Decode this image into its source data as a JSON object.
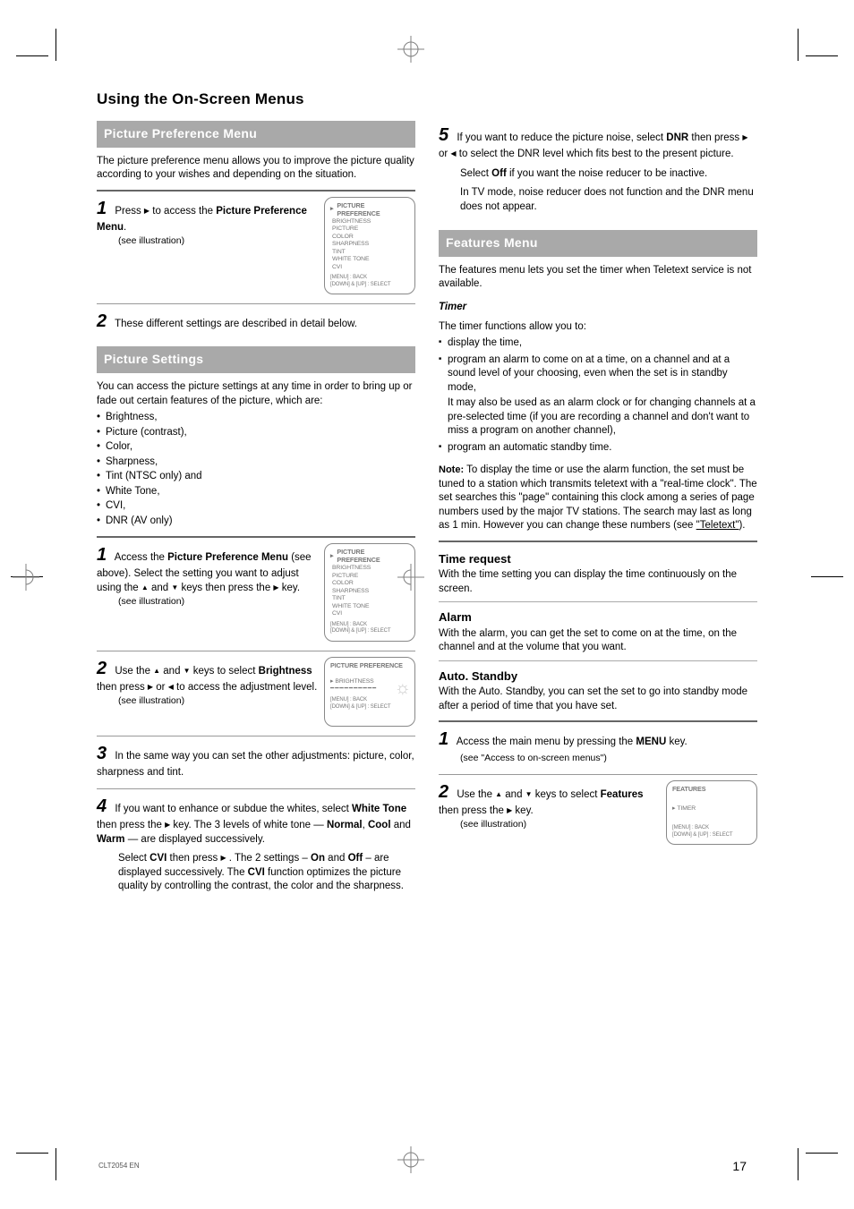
{
  "page": {
    "header": "Using the On-Screen Menus",
    "number": "17",
    "footer_model": "CLT2054 EN"
  },
  "left": {
    "sec1_title": "Picture Preference Menu",
    "sec1_p1": "The picture preference menu allows you to improve the picture quality according to your wishes and depending on the situation.",
    "step1": "Press ▶ to access the Picture Preference Menu.",
    "step1_after": "(see illustration)",
    "screen1": {
      "header": "PICTURE PREFERENCE",
      "items": [
        "BRIGHTNESS",
        "PICTURE",
        "COLOR",
        "SHARPNESS",
        "TINT",
        "WHITE TONE",
        "CVI"
      ],
      "note1": "[MENU] : BACK",
      "note2": "[DOWN] & [UP] : SELECT"
    },
    "step2": "These different settings are described in detail below.",
    "sec2_title": "Picture Settings",
    "sec2_intro": "You can access the picture settings at any time in order to bring up or fade out certain features of the picture, which are:",
    "sec2_list": [
      "Brightness,",
      "Picture (contrast),",
      "Color,",
      "Sharpness,",
      "Tint (NTSC only) and",
      "White Tone,",
      "CVI,",
      "DNR (AV only)"
    ],
    "stepA_num": "1",
    "stepA_text": "Access the Picture Preference Menu (see above). Select the setting you want to adjust using the ▲ and ▼ keys then press the ▶ key.",
    "stepA_after": "(see illustration)",
    "stepB_num": "2",
    "stepB_text_a": "Use the ▲ and ▼ keys to select Brightness then",
    "stepB_text_b": "press ▶ or ◀ to access the adjustment level.",
    "stepB_after": "(see illustration)",
    "screenB_header": "PICTURE PREFERENCE",
    "screenB_row": "BRIGHTNESS",
    "screenB_bar": "■■■■■■■■",
    "stepC_num": "3",
    "stepC_text": "In the same way you can set the other adjustments: picture, color, sharpness and tint.",
    "stepD_num": "4",
    "stepD_text1": "If you want to enhance or subdue the whites, select White Tone then press the ▶ key. The 3 levels of white tone — Normal, Cool and Warm — are displayed successively.",
    "stepD_text2": "Select CVI then press ▶ . The 2 settings – On and Off – are displayed successively. The CVI function optimizes the picture quality by controlling the contrast, the color and the sharpness."
  },
  "right": {
    "step5_num": "5",
    "step5_text1": "If you want to reduce the picture noise, select DNR then press ▶ or ◀ to select the DNR level which fits best to the present picture.",
    "step5_text2": "Select Off if you want the noise reducer to be inactive.",
    "step5_text3": "In TV mode, noise reducer does not function and the DNR menu does not appear.",
    "sec3_title": "Features Menu",
    "sec3_p": "The features menu lets you set the timer when Teletext service is not available.",
    "sec3_sub": "Timer",
    "sec3_intro": "The timer functions allow you to:",
    "sec3_li1": "display the time,",
    "sec3_li2_a": "program an alarm to come on at a time, on a channel and at a sound level of your choosing, even when the set is in standby mode,",
    "sec3_li2_b": "It may also be used as an alarm clock or for changing channels at a pre-selected time (if you are recording a channel and don't want to miss a program on another channel),",
    "sec3_li3": "program an automatic standby time.",
    "sec3_note_lbl": "Note:",
    "sec3_note": "To display the time or use the alarm function, the set must be tuned to a station which transmits teletext with a \"real-time clock\". The set searches this \"page\" containing this clock among a series of page numbers used by the major TV stations. The search may last as long as 1 min. However you can change these numbers (see \"Teletext\").",
    "time_h": "Time request",
    "time_p": "With the time setting you can display the time continuously on the screen.",
    "alarm_h": "Alarm",
    "alarm_p": "With the alarm, you can get the set to come on at the time, on the channel and at the volume that you want.",
    "auto_h": "Auto. Standby",
    "auto_p": "With the Auto. Standby, you can set the set to go into standby mode after a period of time that you have set.",
    "rstep1_num": "1",
    "rstep1_text": "Access the main menu by pressing the MENU key.",
    "rstep1_see": "(see \"Access to on-screen menus\")",
    "rstep2_num": "2",
    "rstep2_text": "Use the ▲ and ▼ keys to select Features then press the ▶ key.",
    "rstep2_after": "(see illustration)",
    "screenR_header": "FEATURES",
    "screenR_items": [
      "TIMER"
    ],
    "screenR_note1": "[MENU] : BACK",
    "screenR_note2": "[DOWN] & [UP] : SELECT"
  }
}
